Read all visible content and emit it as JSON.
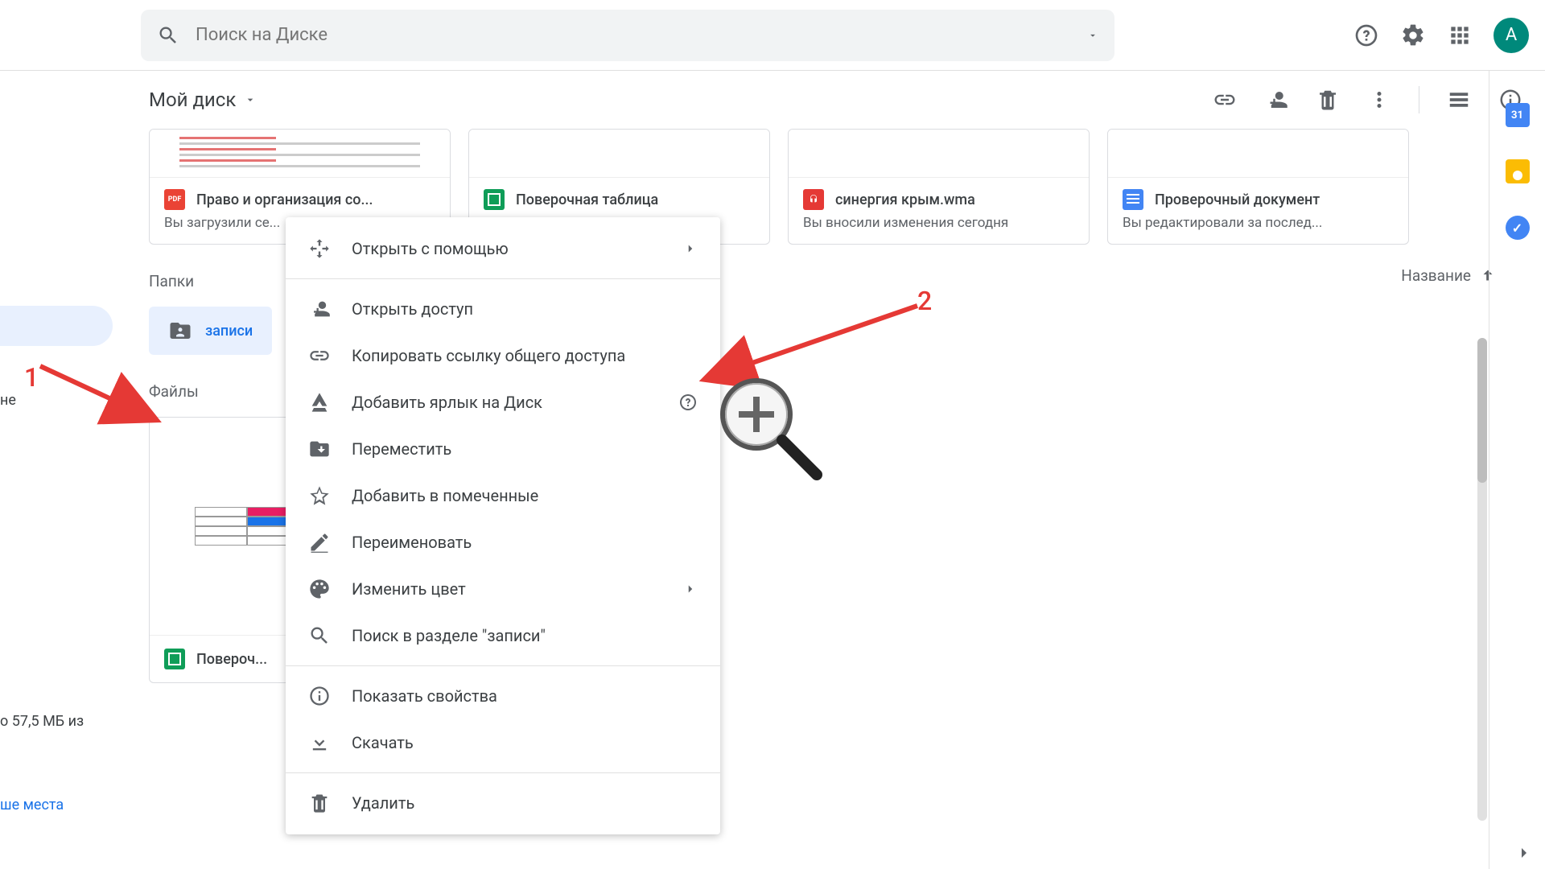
{
  "search": {
    "placeholder": "Поиск на Диске"
  },
  "avatar_letter": "А",
  "breadcrumb": "Мой диск",
  "sidebar": {
    "partial_1": "не",
    "storage": "о 57,5 МБ из",
    "buy": "ше места"
  },
  "cards": [
    {
      "icon": "pdf",
      "name": "Право и организация со...",
      "sub": "Вы загрузили се..."
    },
    {
      "icon": "sheet",
      "name": "Поверочная таблица",
      "sub": ""
    },
    {
      "icon": "audio",
      "name": "синергия крым.wma",
      "sub": "Вы вносили изменения сегодня"
    },
    {
      "icon": "doc",
      "name": "Проверочный документ",
      "sub": "Вы редактировали за послед..."
    }
  ],
  "sections": {
    "folders": "Папки",
    "files": "Файлы",
    "sort": "Название"
  },
  "folder": {
    "label": "записи"
  },
  "file_grid": {
    "name": "Повероч..."
  },
  "context_menu": {
    "open_with": "Открыть с помощью",
    "share": "Открыть доступ",
    "copy_link": "Копировать ссылку общего доступа",
    "add_shortcut": "Добавить ярлык на Диск",
    "move": "Переместить",
    "star": "Добавить в помеченные",
    "rename": "Переименовать",
    "color": "Изменить цвет",
    "search_in": "Поиск в разделе \"записи\"",
    "details": "Показать свойства",
    "download": "Скачать",
    "delete": "Удалить"
  },
  "annotations": {
    "one": "1",
    "two": "2"
  },
  "side": {
    "cal": "31"
  }
}
